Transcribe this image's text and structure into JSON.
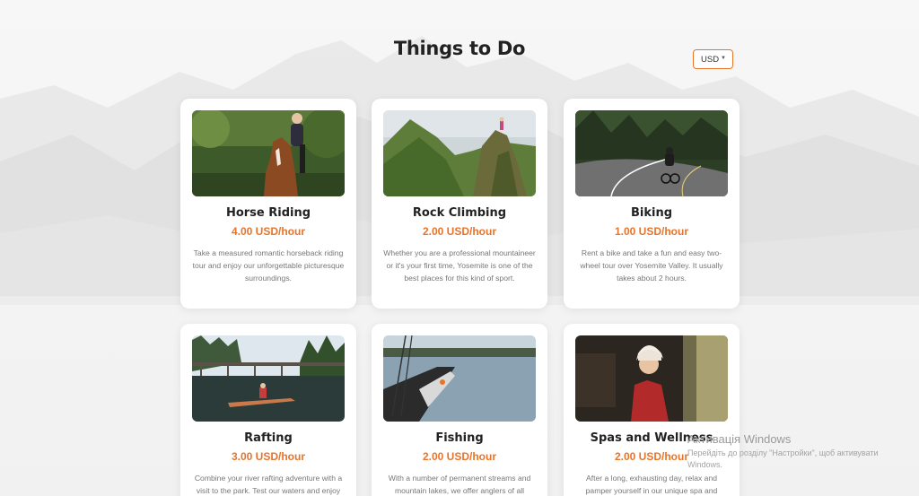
{
  "page": {
    "title": "Things to Do"
  },
  "currency_select": {
    "value": "USD"
  },
  "activities": [
    {
      "name": "Horse Riding",
      "price": "4.00 USD/hour",
      "description": "Take a measured romantic horseback riding tour and enjoy our unforgettable picturesque surroundings."
    },
    {
      "name": "Rock Climbing",
      "price": "2.00 USD/hour",
      "description": "Whether you are a professional mountaineer or it's your first time, Yosemite is one of the best places for this kind of sport."
    },
    {
      "name": "Biking",
      "price": "1.00 USD/hour",
      "description": "Rent a bike and take a fun and easy two-wheel tour over Yosemite Valley. It usually takes about 2 hours."
    },
    {
      "name": "Rafting",
      "price": "3.00 USD/hour",
      "description": "Combine your river rafting adventure with a visit to the park. Test our waters and enjoy"
    },
    {
      "name": "Fishing",
      "price": "2.00 USD/hour",
      "description": "With a number of permanent streams and mountain lakes, we offer anglers of all"
    },
    {
      "name": "Spas and Wellness",
      "price": "2.00 USD/hour",
      "description": "After a long, exhausting day, relax and pamper yourself in our unique spa and"
    }
  ],
  "watermark": {
    "title": "Активація Windows",
    "subtitle": "Перейдіть до розділу \"Настройки\", щоб активувати Windows."
  },
  "colors": {
    "accent": "#e8742a",
    "background": "#f3f3f3",
    "card": "#ffffff"
  }
}
